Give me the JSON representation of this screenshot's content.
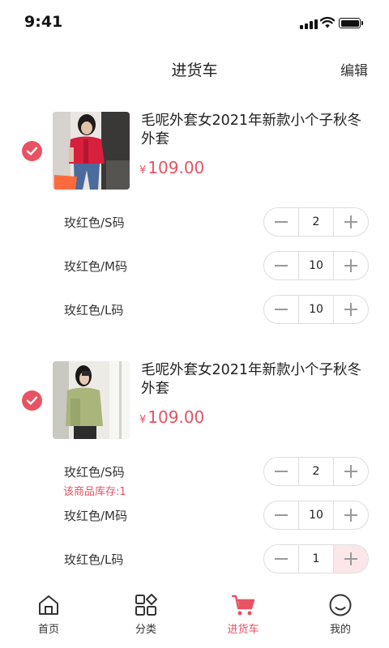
{
  "status_bar": {
    "time": "9:41",
    "icons": [
      "signal-icon",
      "wifi-icon",
      "battery-icon"
    ]
  },
  "nav": {
    "title": "进货车",
    "edit_label": "编辑"
  },
  "colors": {
    "accent": "#e85262",
    "text": "#333333",
    "border": "#dddddd",
    "active_step_bg": "#fbe7e9"
  },
  "products": [
    {
      "selected": true,
      "title": "毛呢外套女2021年新款小个子秋冬外套",
      "currency": "¥",
      "price": "109.00",
      "thumbnail": "red-jacket-photo",
      "skus": [
        {
          "label": "玫红色/S码",
          "quantity": "2"
        },
        {
          "label": "玫红色/M码",
          "quantity": "10"
        },
        {
          "label": "玫红色/L码",
          "quantity": "10"
        }
      ]
    },
    {
      "selected": true,
      "title": "毛呢外套女2021年新款小个子秋冬外套",
      "currency": "¥",
      "price": "109.00",
      "thumbnail": "green-sweater-photo",
      "skus": [
        {
          "label": "玫红色/S码",
          "quantity": "2"
        },
        {
          "label": "玫红色/M码",
          "quantity": "10"
        },
        {
          "label": "玫红色/L码",
          "quantity": "1"
        }
      ],
      "stock_warning": "该商品库存:1"
    }
  ],
  "tabs": [
    {
      "label": "首页",
      "icon": "home-icon",
      "active": false
    },
    {
      "label": "分类",
      "icon": "category-icon",
      "active": false
    },
    {
      "label": "进货车",
      "icon": "cart-icon",
      "active": true
    },
    {
      "label": "我的",
      "icon": "profile-icon",
      "active": false
    }
  ]
}
